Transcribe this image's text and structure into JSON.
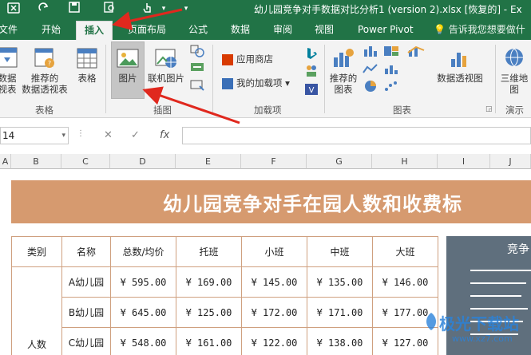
{
  "titlebar": {
    "title": "幼儿园竞争对手数据对比分析1 (version 2).xlsx [恢复的] - Ex",
    "icons": [
      "excel-logo-icon",
      "save-icon",
      "print-preview-icon",
      "touch-mode-icon",
      "customize-qat-icon"
    ]
  },
  "tabs": [
    {
      "label": "文件"
    },
    {
      "label": "开始"
    },
    {
      "label": "插入"
    },
    {
      "label": "页面布局"
    },
    {
      "label": "公式"
    },
    {
      "label": "数据"
    },
    {
      "label": "审阅"
    },
    {
      "label": "视图"
    },
    {
      "label": "Power Pivot"
    }
  ],
  "tell_me": "告诉我您想要做什",
  "ribbon": {
    "tables": {
      "pivot_line1": "数据",
      "pivot_line2": "视表",
      "recommended_pivot_line1": "推荐的",
      "recommended_pivot_line2": "数据透视表",
      "table": "表格",
      "group": "表格"
    },
    "illustrations": {
      "picture": "图片",
      "online_picture": "联机图片",
      "group": "插图"
    },
    "addins": {
      "store": "应用商店",
      "my_addins": "我的加载项",
      "group": "加载项"
    },
    "charts": {
      "recommended_line1": "推荐的",
      "recommended_line2": "图表",
      "pivot_chart": "数据透视图",
      "group": "图表"
    },
    "tours": {
      "map3d_line1": "三维地",
      "map3d_line2": "图",
      "group": "演示"
    }
  },
  "formula_bar": {
    "name_box": "14",
    "fx": "fx",
    "value": ""
  },
  "columns": [
    "A",
    "B",
    "C",
    "D",
    "E",
    "F",
    "G",
    "H",
    "I",
    "J"
  ],
  "sheet": {
    "banner_title": "幼儿园竞争对手在园人数和收费标",
    "table": {
      "headers": [
        "类别",
        "名称",
        "总数/均价",
        "托班",
        "小班",
        "中班",
        "大班"
      ],
      "category": "人数",
      "rows": [
        {
          "name": "A幼儿园",
          "total": "¥ 595.00",
          "tuo": "¥ 169.00",
          "xiao": "¥ 145.00",
          "zhong": "¥ 135.00",
          "da": "¥ 146.00"
        },
        {
          "name": "B幼儿园",
          "total": "¥ 645.00",
          "tuo": "¥ 125.00",
          "xiao": "¥ 172.00",
          "zhong": "¥ 171.00",
          "da": "¥ 177.00"
        },
        {
          "name": "C幼儿园",
          "total": "¥ 548.00",
          "tuo": "¥ 161.00",
          "xiao": "¥ 122.00",
          "zhong": "¥ 138.00",
          "da": "¥ 127.00"
        }
      ]
    },
    "side_panel_title": "竞争"
  },
  "watermark": {
    "text": "极光下载站",
    "sub": "www.xz7.com"
  },
  "colors": {
    "excel_green": "#217346",
    "banner": "#d69a6f",
    "table_border": "#cfa07f",
    "side_panel": "#5f6f7d",
    "annotation_arrow": "#e0281e"
  }
}
